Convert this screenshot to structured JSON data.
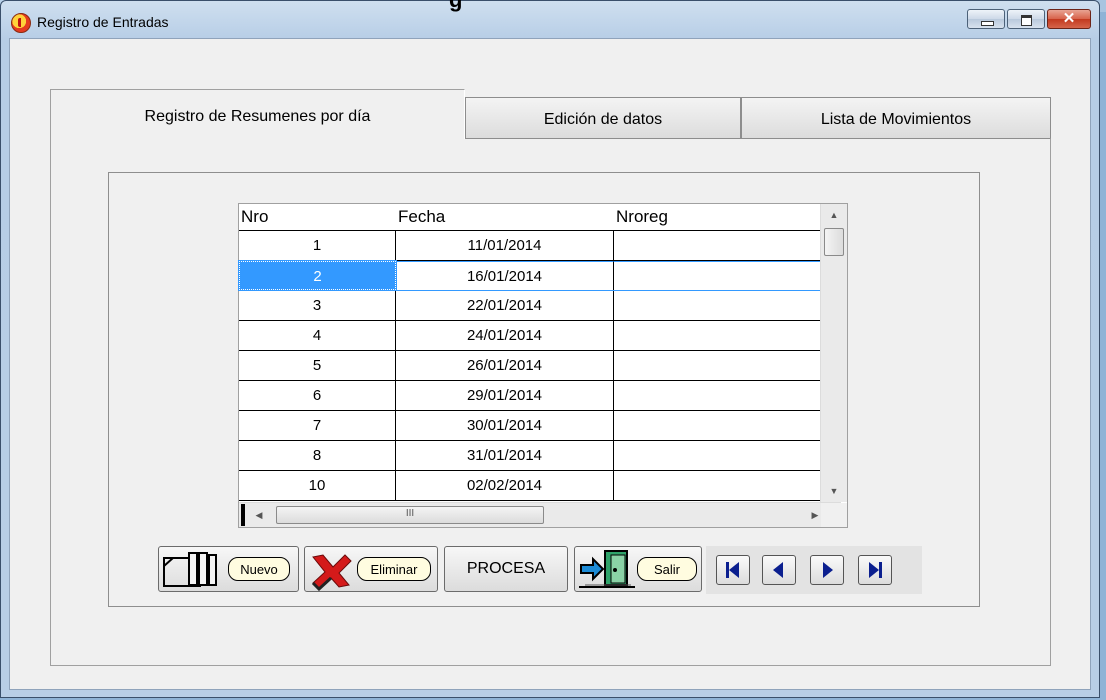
{
  "window": {
    "title": "Registro de Entradas",
    "partial_heading": "g",
    "close_glyph": "✕"
  },
  "tabs": [
    {
      "label": "Registro de Resumenes por día",
      "active": true
    },
    {
      "label": "Edición de datos",
      "active": false
    },
    {
      "label": "Lista de Movimientos",
      "active": false
    }
  ],
  "grid": {
    "columns": [
      "Nro",
      "Fecha",
      "Nroreg"
    ],
    "rows": [
      {
        "nro": "1",
        "fecha": "11/01/2014",
        "nroreg": ""
      },
      {
        "nro": "2",
        "fecha": "16/01/2014",
        "nroreg": "",
        "selected": true
      },
      {
        "nro": "3",
        "fecha": "22/01/2014",
        "nroreg": ""
      },
      {
        "nro": "4",
        "fecha": "24/01/2014",
        "nroreg": ""
      },
      {
        "nro": "5",
        "fecha": "26/01/2014",
        "nroreg": ""
      },
      {
        "nro": "6",
        "fecha": "29/01/2014",
        "nroreg": ""
      },
      {
        "nro": "7",
        "fecha": "30/01/2014",
        "nroreg": ""
      },
      {
        "nro": "8",
        "fecha": "31/01/2014",
        "nroreg": ""
      },
      {
        "nro": "10",
        "fecha": "02/02/2014",
        "nroreg": ""
      }
    ],
    "hscroll_thumb_glyph": "III"
  },
  "toolbar": {
    "nuevo_label": "Nuevo",
    "eliminar_label": "Eliminar",
    "procesa_label": "PROCESA",
    "salir_label": "Salir"
  },
  "icons": {
    "nuevo": "folder-documents-icon",
    "eliminar": "red-x-delete-icon",
    "salir": "exit-door-icon",
    "nav_first": "first-record-icon",
    "nav_prev": "previous-record-icon",
    "nav_next": "next-record-icon",
    "nav_last": "last-record-icon"
  },
  "colors": {
    "selection": "#3399ff",
    "nav_arrow": "#0b1f8f",
    "delete_red": "#d41a1a"
  }
}
